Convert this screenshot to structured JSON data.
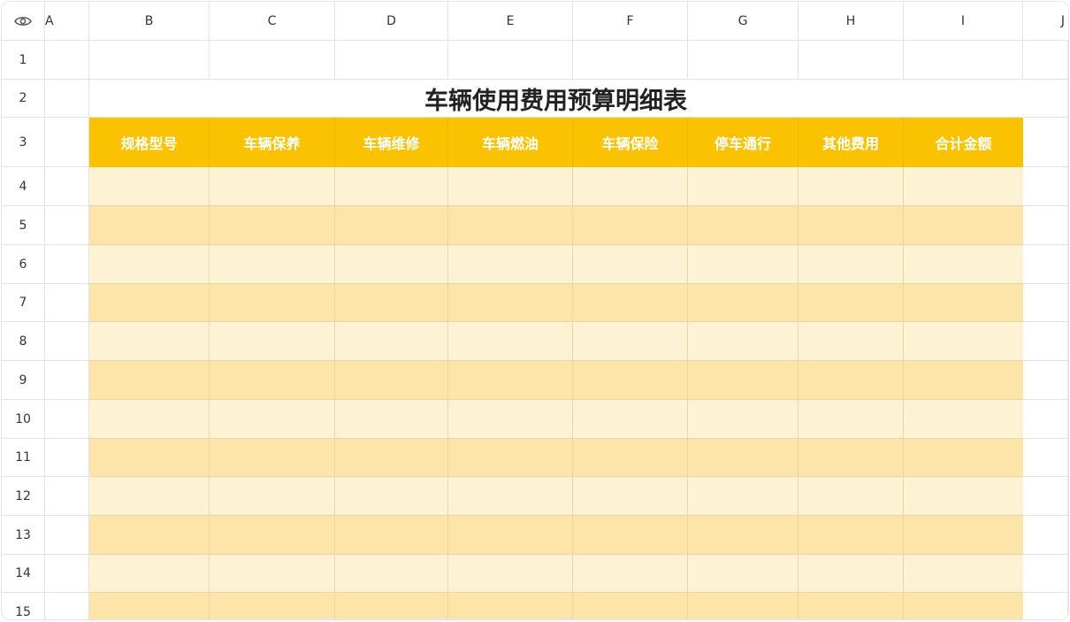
{
  "column_headers": [
    "A",
    "B",
    "C",
    "D",
    "E",
    "F",
    "G",
    "H",
    "I",
    "J"
  ],
  "row_headers": [
    "1",
    "2",
    "3",
    "4",
    "5",
    "6",
    "7",
    "8",
    "9",
    "10",
    "11",
    "12",
    "13",
    "14",
    "15"
  ],
  "corner_icon": "eye-icon",
  "sheet": {
    "title": "车辆使用费用预算明细表",
    "table_headers": [
      "规格型号",
      "车辆保养",
      "车辆维修",
      "车辆燃油",
      "车辆保险",
      "停车通行",
      "其他费用",
      "合计金额"
    ],
    "data_rows": [
      [
        "",
        "",
        "",
        "",
        "",
        "",
        "",
        ""
      ],
      [
        "",
        "",
        "",
        "",
        "",
        "",
        "",
        ""
      ],
      [
        "",
        "",
        "",
        "",
        "",
        "",
        "",
        ""
      ],
      [
        "",
        "",
        "",
        "",
        "",
        "",
        "",
        ""
      ],
      [
        "",
        "",
        "",
        "",
        "",
        "",
        "",
        ""
      ],
      [
        "",
        "",
        "",
        "",
        "",
        "",
        "",
        ""
      ],
      [
        "",
        "",
        "",
        "",
        "",
        "",
        "",
        ""
      ],
      [
        "",
        "",
        "",
        "",
        "",
        "",
        "",
        ""
      ],
      [
        "",
        "",
        "",
        "",
        "",
        "",
        "",
        ""
      ],
      [
        "",
        "",
        "",
        "",
        "",
        "",
        "",
        ""
      ],
      [
        "",
        "",
        "",
        "",
        "",
        "",
        "",
        ""
      ],
      [
        "",
        "",
        "",
        "",
        "",
        "",
        "",
        ""
      ]
    ]
  },
  "colors": {
    "header_fill": "#fac200",
    "band_light": "#fef2d4",
    "band_dark": "#fde4a9",
    "grid_line": "#e3e3e3"
  }
}
